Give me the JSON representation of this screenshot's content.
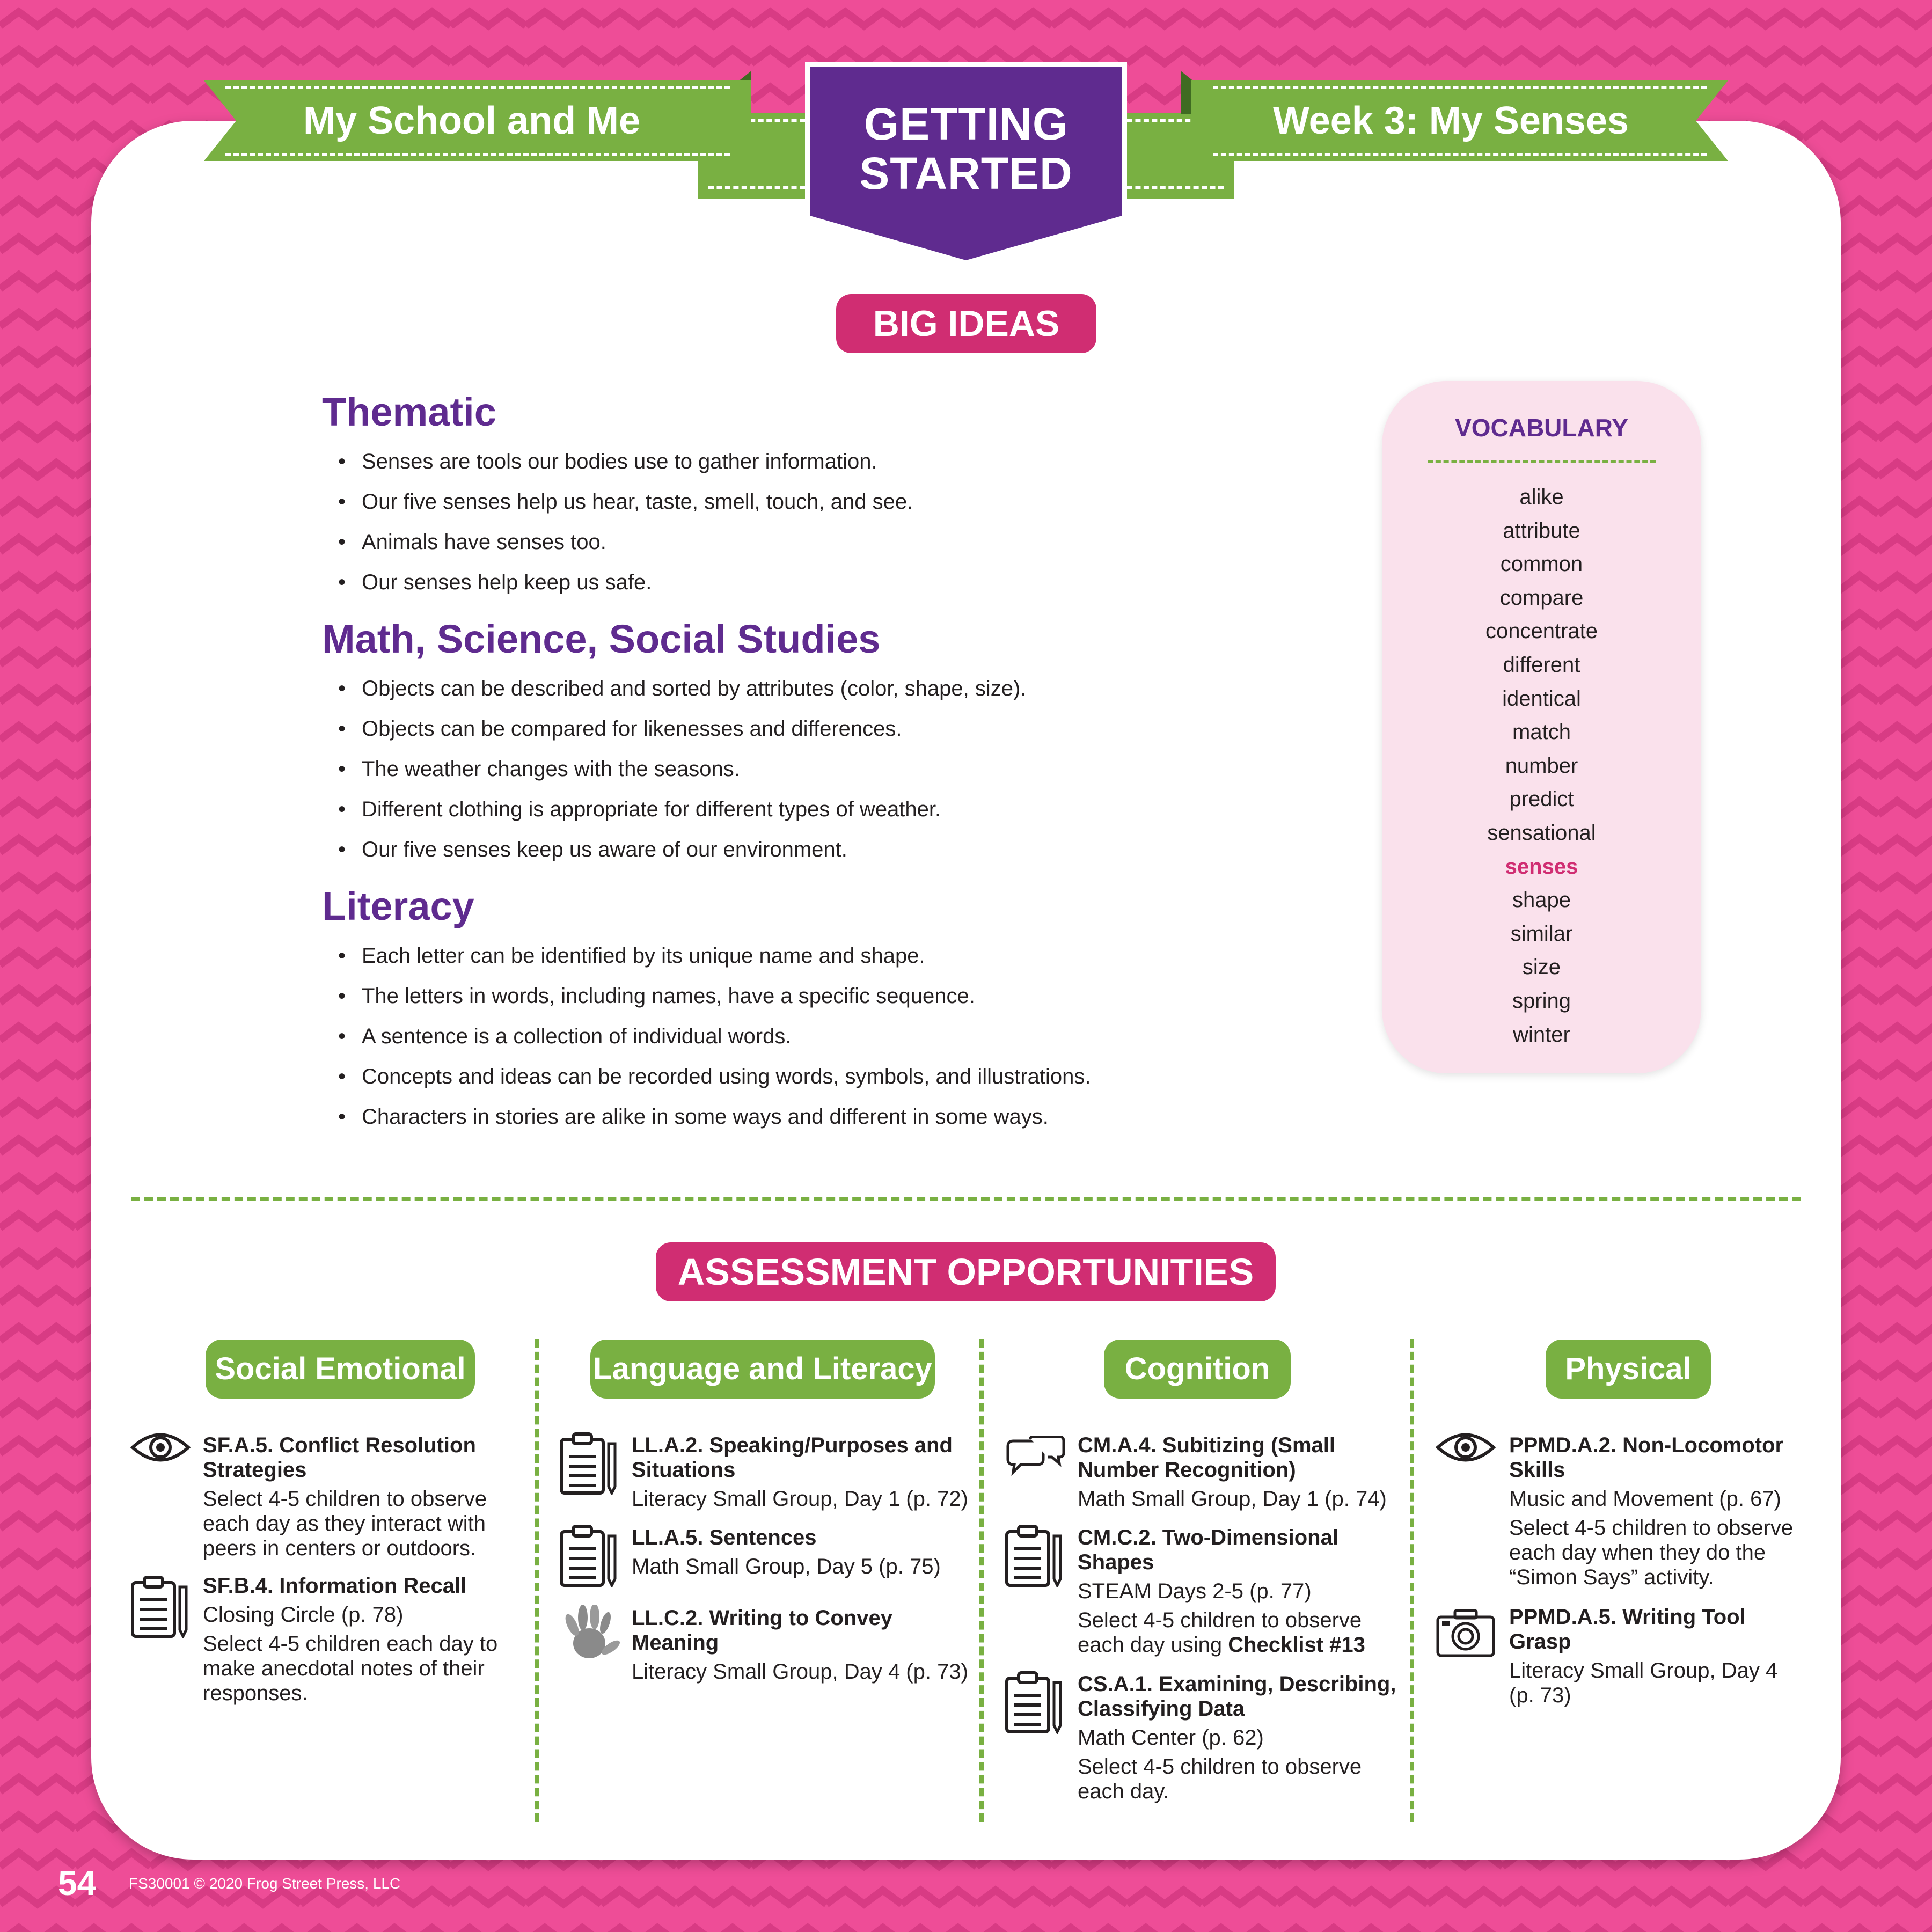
{
  "banner": {
    "left_title": "My School and Me",
    "center_title_line1": "GETTING",
    "center_title_line2": "STARTED",
    "right_title": "Week 3: My Senses"
  },
  "colors": {
    "background_pink": "#ee4d97",
    "green": "#79b042",
    "purple": "#5f2b8f",
    "magenta": "#d02d72",
    "vocab_bg": "#fae1ec"
  },
  "big_ideas": {
    "label": "BIG IDEAS",
    "sections": [
      {
        "heading": "Thematic",
        "bullets": [
          "Senses are tools our bodies use to gather information.",
          "Our five senses help us hear, taste, smell, touch, and see.",
          "Animals have senses too.",
          "Our senses help keep us safe."
        ]
      },
      {
        "heading": "Math, Science, Social Studies",
        "bullets": [
          "Objects can be described and sorted by attributes (color, shape, size).",
          "Objects can be compared for likenesses and differences.",
          "The weather changes with the seasons.",
          "Different clothing is appropriate for different types of weather.",
          "Our five senses keep us aware of our environment."
        ]
      },
      {
        "heading": "Literacy",
        "bullets": [
          "Each letter can be identified by its unique name and shape.",
          "The letters in words, including names, have a specific sequence.",
          "A sentence is a collection of individual words.",
          "Concepts and ideas can be recorded using words, symbols, and illustrations.",
          "Characters in stories are alike in some ways and different in some ways."
        ]
      }
    ]
  },
  "vocabulary": {
    "title": "VOCABULARY",
    "words": [
      "alike",
      "attribute",
      "common",
      "compare",
      "concentrate",
      "different",
      "identical",
      "match",
      "number",
      "predict",
      "sensational",
      "senses",
      "shape",
      "similar",
      "size",
      "spring",
      "winter"
    ],
    "highlighted": "senses"
  },
  "assessment": {
    "label": "ASSESSMENT OPPORTUNITIES",
    "columns": [
      {
        "category": "Social Emotional",
        "items": [
          {
            "icon": "eye-icon",
            "code_line1": "SF.A.5. Conflict Resolution",
            "code_line2": "Strategies",
            "lines": [
              [
                "Select 4-5 children to observe",
                "each day as they interact with",
                "peers in centers or outdoors."
              ]
            ]
          },
          {
            "icon": "clipboard-icon",
            "code_line1": "SF.B.4. Information Recall",
            "lines": [
              [
                "Closing Circle (p. 78)"
              ],
              [
                "Select 4-5 children each day to",
                "make anecdotal notes of their",
                "responses."
              ]
            ]
          }
        ]
      },
      {
        "category": "Language and Literacy",
        "items": [
          {
            "icon": "clipboard-icon",
            "code_line1": "LL.A.2. Speaking/Purposes and",
            "code_line2": "Situations",
            "lines": [
              [
                "Literacy Small Group, Day 1 (p. 72)"
              ]
            ]
          },
          {
            "icon": "clipboard-icon",
            "code_line1": "LL.A.5. Sentences",
            "lines": [
              [
                "Math Small Group, Day 5 (p. 75)"
              ]
            ]
          },
          {
            "icon": "handprint-icon",
            "code_line1": "LL.C.2. Writing to Convey",
            "code_line2": "Meaning",
            "lines": [
              [
                "Literacy Small Group, Day 4 (p. 73)"
              ]
            ]
          }
        ]
      },
      {
        "category": "Cognition",
        "items": [
          {
            "icon": "speech-bubbles-icon",
            "code_line1": "CM.A.4. Subitizing (Small",
            "code_line2": "Number Recognition)",
            "lines": [
              [
                "Math Small Group, Day 1 (p. 74)"
              ]
            ]
          },
          {
            "icon": "clipboard-icon",
            "code_line1": "CM.C.2. Two-Dimensional",
            "code_line2": "Shapes",
            "lines": [
              [
                "STEAM Days 2-5 (p. 77)"
              ],
              [
                "Select 4-5 children to observe",
                "each day using "
              ]
            ],
            "bold_suffix": "Checklist #13"
          },
          {
            "icon": "clipboard-icon",
            "code_line1": "CS.A.1. Examining, Describing,",
            "code_line2": "Classifying Data",
            "lines": [
              [
                "Math Center (p. 62)"
              ],
              [
                "Select 4-5 children to observe",
                "each day."
              ]
            ]
          }
        ]
      },
      {
        "category": "Physical",
        "items": [
          {
            "icon": "eye-icon",
            "code_line1": "PPMD.A.2. Non-Locomotor",
            "code_line2": "Skills",
            "lines": [
              [
                "Music and Movement (p. 67)"
              ],
              [
                "Select 4-5 children to observe",
                "each day when they do the",
                "“Simon Says” activity."
              ]
            ]
          },
          {
            "icon": "camera-icon",
            "code_line1": "PPMD.A.5. Writing Tool",
            "code_line2": "Grasp",
            "lines": [
              [
                "Literacy Small Group, Day 4",
                "(p. 73)"
              ]
            ]
          }
        ]
      }
    ]
  },
  "footer": {
    "page_number": "54",
    "copyright": "FS30001 © 2020 Frog Street Press, LLC"
  }
}
